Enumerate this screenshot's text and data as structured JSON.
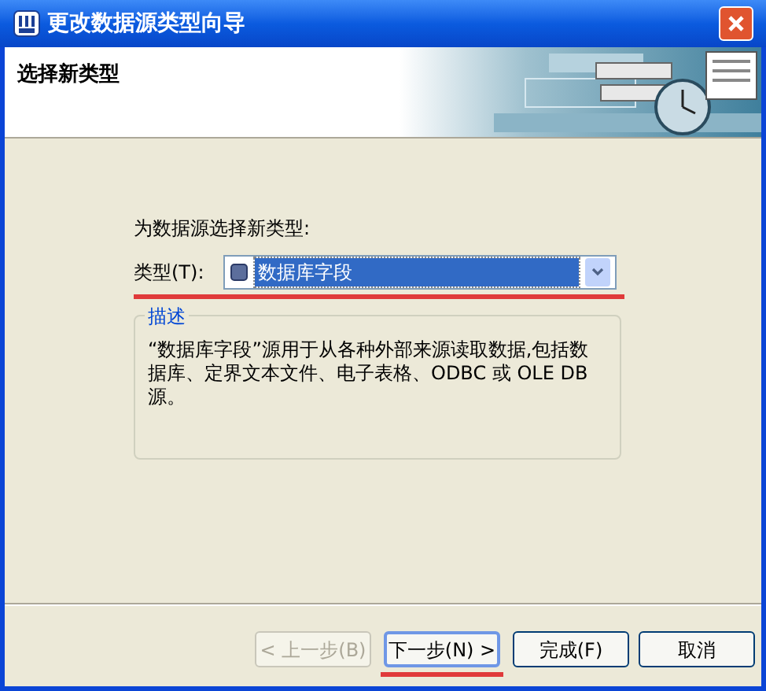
{
  "window": {
    "title": "更改数据源类型向导"
  },
  "header": {
    "title": "选择新类型"
  },
  "prompt": "为数据源选择新类型:",
  "type_field": {
    "label": "类型(T):",
    "value": "数据库字段"
  },
  "description_group": {
    "title": "描述",
    "text": "“数据库字段”源用于从各种外部来源读取数据,包括数据库、定界文本文件、电子表格、ODBC 或 OLE DB 源。"
  },
  "buttons": [
    {
      "label": "< 上一步(B)",
      "disabled": true,
      "default": false
    },
    {
      "label": "下一步(N) >",
      "disabled": false,
      "default": true
    },
    {
      "label": "完成(F)",
      "disabled": false,
      "default": false
    },
    {
      "label": "取消",
      "disabled": false,
      "default": false
    }
  ]
}
